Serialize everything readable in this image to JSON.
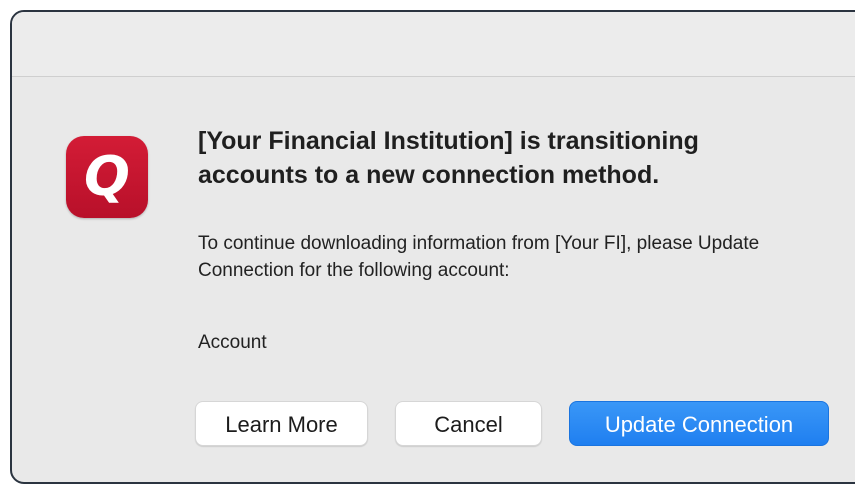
{
  "app_icon": {
    "glyph": "Q",
    "color": "#c8162f"
  },
  "dialog": {
    "heading_fi": "[Your Financial Institution]",
    "heading_rest_line1": " is transitioning",
    "heading_line2": "accounts to a new connection method.",
    "body_part1": "To continue downloading information from ",
    "body_fi": "[Your FI]",
    "body_part2": ", please Update Connection for the following account:",
    "account_label": "Account"
  },
  "buttons": {
    "learn_more": "Learn More",
    "cancel": "Cancel",
    "update_connection": "Update Connection"
  },
  "colors": {
    "primary_button": "#2a8af5",
    "dialog_background": "#e9e9e9"
  }
}
